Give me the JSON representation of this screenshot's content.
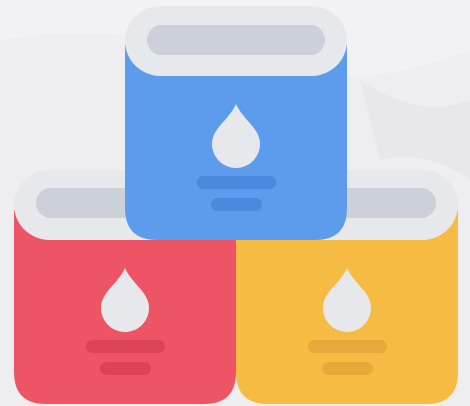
{
  "canvas": {
    "background": "#eeedf0"
  },
  "colors": {
    "lid_outer": "#e6e8ec",
    "lid_inner": "#ccd0d9",
    "drop": "#e6e8ec"
  },
  "cans": [
    {
      "id": "red-paint-can",
      "color": "red",
      "body": "#ed5565",
      "stripe": "#da4453",
      "icon": "water-drop-icon"
    },
    {
      "id": "yellow-paint-can",
      "color": "yellow",
      "body": "#f6bb42",
      "stripe": "#e8a93a",
      "icon": "water-drop-icon"
    },
    {
      "id": "blue-paint-can",
      "color": "blue",
      "body": "#5d9cec",
      "stripe": "#4a89dc",
      "icon": "water-drop-icon"
    }
  ]
}
